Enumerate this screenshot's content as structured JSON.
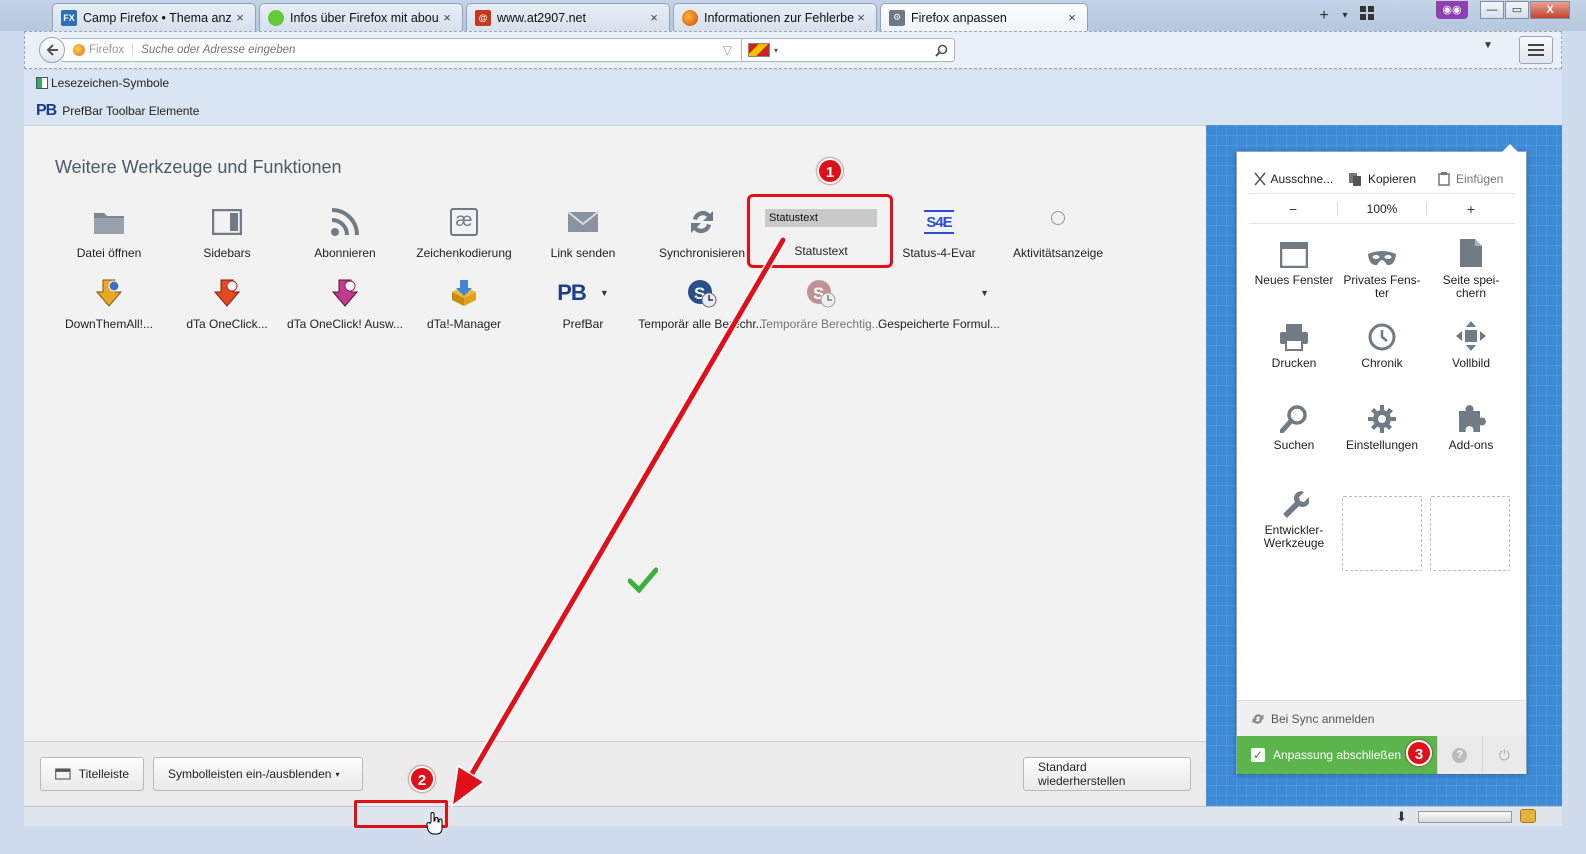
{
  "tabs": [
    {
      "label": "Camp Firefox • Thema anz...",
      "icon": "camp-firefox-icon",
      "active": false
    },
    {
      "label": "Infos über Firefox mit abou...",
      "icon": "speech-bubble-icon",
      "active": false
    },
    {
      "label": "www.at2907.net",
      "icon": "at2907-site-icon",
      "active": false
    },
    {
      "label": "Informationen zur Fehlerbe...",
      "icon": "firefox-icon",
      "active": false
    },
    {
      "label": "Firefox anpassen",
      "icon": "customize-page-icon",
      "active": true
    }
  ],
  "tab_controls": {
    "new_tab": "+",
    "list_all": "▾",
    "close": "×"
  },
  "window_controls": {
    "minimize": "—",
    "restore": "▭",
    "close": "X"
  },
  "navbar": {
    "identity_label": "Firefox",
    "url_placeholder": "Suche oder Adresse eingeben",
    "search_value": ""
  },
  "bookmarks_toolbar": {
    "label": "Lesezeichen-Symbole"
  },
  "prefbar_toolbar": {
    "logo": "PB",
    "label": "PrefBar Toolbar Elemente"
  },
  "palette": {
    "title": "Weitere Werkzeuge und Funktionen",
    "row1": [
      {
        "label": "Datei öffnen",
        "icon": "folder-icon"
      },
      {
        "label": "Sidebars",
        "icon": "sidebar-icon"
      },
      {
        "label": "Abonnieren",
        "icon": "rss-feed-icon"
      },
      {
        "label": "Zeichenkodierung",
        "icon": "character-encoding-icon",
        "glyph": "æ"
      },
      {
        "label": "Link senden",
        "icon": "envelope-icon"
      },
      {
        "label": "Synchronisieren",
        "icon": "sync-icon"
      },
      {
        "label": "Statustext",
        "icon": "status-text-field",
        "field_text": "Statustext"
      },
      {
        "label": "Status-4-Evar",
        "icon": "status4evar-icon",
        "logo": "S4E"
      },
      {
        "label": "Aktivitätsanzeige",
        "icon": "activity-indicator-icon"
      }
    ],
    "row2": [
      {
        "label": "DownThemAll!...",
        "icon": "downthemall-icon"
      },
      {
        "label": "dTa OneClick...",
        "icon": "dta-oneclick-icon"
      },
      {
        "label": "dTa OneClick! Ausw...",
        "icon": "dta-oneclick-select-icon"
      },
      {
        "label": "dTa!-Manager",
        "icon": "dta-manager-icon"
      },
      {
        "label": "PrefBar",
        "icon": "prefbar-icon",
        "logo": "PB"
      },
      {
        "label": "Temporär alle Berechr...",
        "icon": "temp-allow-all-icon"
      },
      {
        "label": "Temporäre Berechtig...",
        "icon": "temp-revoke-icon"
      },
      {
        "label": "Gespeicherte Formul...",
        "icon": "saved-forms-icon"
      }
    ]
  },
  "footer": {
    "titlebar_label": "Titelleiste",
    "toolbars_label": "Symbolleisten ein-/ausblenden",
    "restore_label": "Standard wiederherstellen"
  },
  "menu_panel": {
    "cut": "Ausschne...",
    "copy": "Kopieren",
    "paste": "Einfügen",
    "zoom_out": "−",
    "zoom_value": "100%",
    "zoom_in": "+",
    "items": [
      {
        "label": "Neues Fenster",
        "icon": "new-window-icon"
      },
      {
        "label": "Privates Fens-\nter",
        "icon": "private-mask-icon"
      },
      {
        "label": "Seite spei-\nchern",
        "icon": "save-page-icon"
      },
      {
        "label": "Drucken",
        "icon": "printer-icon"
      },
      {
        "label": "Chronik",
        "icon": "history-clock-icon"
      },
      {
        "label": "Vollbild",
        "icon": "fullscreen-icon"
      },
      {
        "label": "Suchen",
        "icon": "magnifier-icon"
      },
      {
        "label": "Einstellungen",
        "icon": "gear-icon"
      },
      {
        "label": "Add-ons",
        "icon": "puzzle-icon"
      },
      {
        "label": "Entwickler-\nWerkzeuge",
        "icon": "wrench-icon"
      }
    ],
    "sync_label": "Bei Sync anmelden",
    "exit_label": "Anpassung abschließen",
    "help_glyph": "?",
    "quit_glyph": "⏻"
  },
  "annotations": [
    "1",
    "2",
    "3"
  ],
  "colors": {
    "accent_red": "#e0101a",
    "exit_green": "#5cb44c",
    "panel_blue": "#3d8ad6"
  }
}
